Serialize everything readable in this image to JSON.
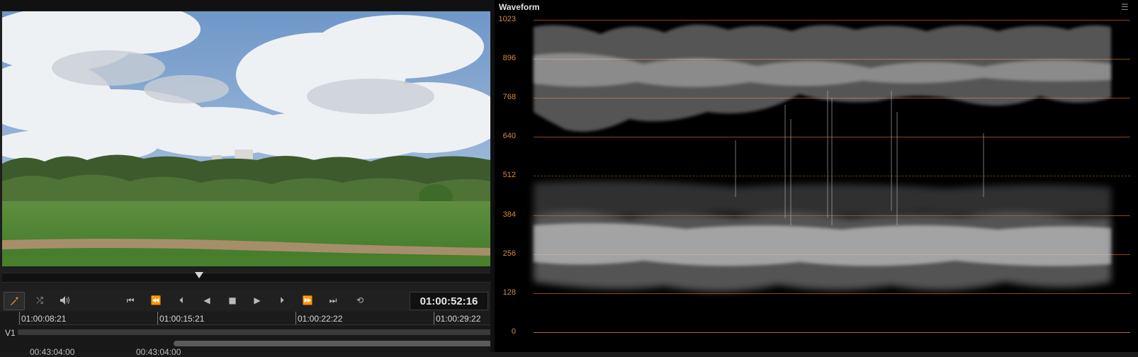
{
  "viewer": {
    "transport_icons": [
      "color-picker-icon",
      "shuffle-icon",
      "volume-icon",
      "skip-to-start-icon",
      "rewind-icon",
      "prev-frame-icon",
      "reverse-play-icon",
      "stop-icon",
      "play-icon",
      "next-frame-icon",
      "fast-forward-icon",
      "skip-to-end-icon",
      "loop-icon"
    ],
    "timecode": "01:00:52:16"
  },
  "timeline": {
    "ruler": [
      "01:00:08:21",
      "01:00:15:21",
      "01:00:22:22",
      "01:00:29:22"
    ],
    "track_label": "V1",
    "lower_timecodes": [
      "00:43:04:00",
      "00:43:04:00"
    ]
  },
  "scope": {
    "title": "Waveform",
    "menu_icon": "menu-icon",
    "scale": [
      "1023",
      "896",
      "768",
      "640",
      "512",
      "384",
      "256",
      "128",
      "0"
    ],
    "accent_color": "#d48a3c"
  }
}
